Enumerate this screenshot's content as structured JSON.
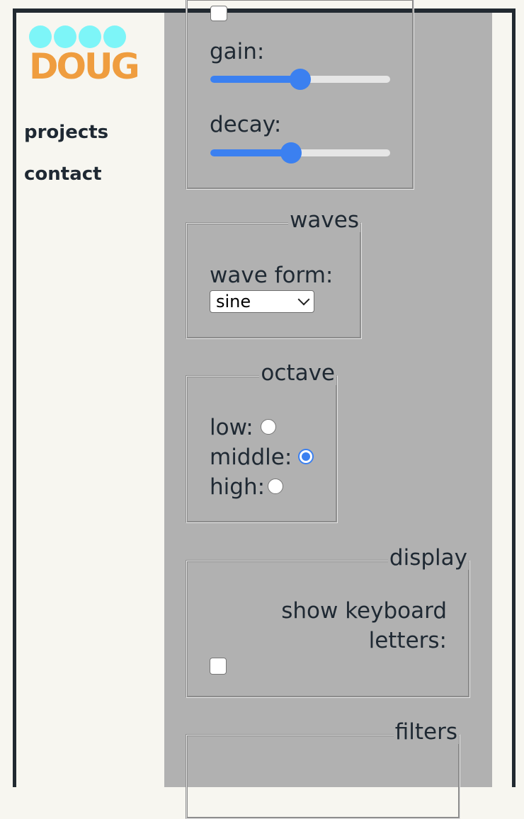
{
  "logo": {
    "text": "DOUG"
  },
  "nav": {
    "projects": "projects",
    "contact": "contact"
  },
  "envelope": {
    "gain_label": "gain:",
    "gain_value": 0.5,
    "decay_label": "decay:",
    "decay_value": 0.45
  },
  "waves": {
    "legend": "waves",
    "wave_form_label": "wave form:",
    "selected": "sine"
  },
  "octave": {
    "legend": "octave",
    "options": [
      {
        "label": "low:",
        "selected": false
      },
      {
        "label": "middle:",
        "selected": true
      },
      {
        "label": "high:",
        "selected": false
      }
    ]
  },
  "display": {
    "legend": "display",
    "show_letters_label_line1": "show keyboard",
    "show_letters_label_line2": "letters:",
    "checked": false
  },
  "filters": {
    "legend": "filters"
  },
  "colors": {
    "accent": "#3b80f0",
    "logo_dots": "#7df5f8",
    "logo_text": "#ef9d3f",
    "panel": "#b1b1b1"
  }
}
